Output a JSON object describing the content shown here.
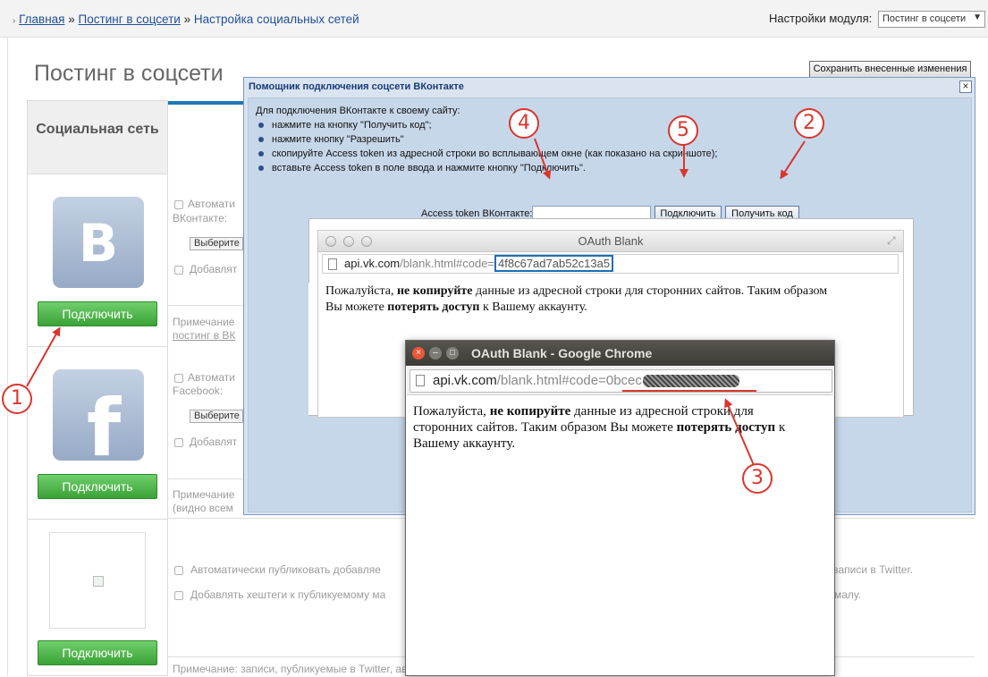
{
  "breadcrumb": {
    "home": "Главная",
    "sep": "»",
    "posting": "Постинг в соцсети",
    "current": "Настройка социальных сетей"
  },
  "module": {
    "label": "Настройки модуля:",
    "selected": "Постинг в соцсети"
  },
  "page": {
    "title": "Постинг в соцсети",
    "save_label": "Сохранить внесенные изменения"
  },
  "social": {
    "header": "Социальная сеть",
    "items": [
      {
        "logo": "vk-logo",
        "letter": "B",
        "connect_label": "Подключить"
      },
      {
        "logo": "facebook-logo",
        "letter": "f",
        "connect_label": "Подключить"
      },
      {
        "logo": "twitter-logo-broken",
        "letter": "",
        "connect_label": "Подключить"
      }
    ]
  },
  "settings": {
    "vk": {
      "auto_line1": "Автомати",
      "auto_line2": "ВКонтакте:",
      "select_btn": "Выберите",
      "add_label": "Добавлят",
      "note_line1": "Примечание",
      "note_line2": "постинг в ВК"
    },
    "fb": {
      "auto_line1": "Автомати",
      "auto_line2": "Facebook:",
      "select_btn": "Выберите",
      "add_label": "Добавлят",
      "note_line1": "Примечание",
      "note_line2": "(видно всем"
    },
    "tw": {
      "auto_left": "Автоматически публиковать добавляе",
      "auto_right": "записи в Twitter.",
      "hashtags_left": "Добавлять хештеги к публикуемому ма",
      "hashtags_right": "малу.",
      "note": "Примечание: записи, публикуемые в Twitter, автоматически сокращаются до 140 символов, вне зависимости от настроек модуля."
    }
  },
  "modal": {
    "title": "Помощник подключения соцсети ВКонтакте",
    "close": "×",
    "intro": "Для подключения ВКонтакте к своему сайту:",
    "steps": [
      "нажмите на кнопку \"Получить код\";",
      "нажмите кнопку \"Разрешить\"",
      "скопируйте Access token из адресной строки во всплывающем окне (как показано на скриншоте);",
      "вставьте Access token в поле ввода и нажмите кнопку \"Подключить\"."
    ],
    "token_label": "Access token ВКонтакте:",
    "token_value": "",
    "connect_label": "Подключить",
    "get_code_label": "Получить код"
  },
  "oauth_window": {
    "title": "OAuth Blank",
    "url_domain": "api.vk.com",
    "url_path": "/blank.html#code=",
    "code": "4f8c67ad7ab52c13a5",
    "warn_pre": "Пожалуйста, ",
    "warn_bold1": "не копируйте",
    "warn_mid": " данные из адресной строки для сторонних сайтов. Таким образом",
    "warn_line2_pre": "Вы можете ",
    "warn_bold2": "потерять доступ",
    "warn_post": " к Вашему аккаунту."
  },
  "chrome_window": {
    "title": "OAuth Blank - Google Chrome",
    "url_domain": "api.vk.com",
    "url_path": "/blank.html#code=",
    "code_visible": "0bcec",
    "warn_pre": "Пожалуйста, ",
    "warn_bold1": "не копируйте",
    "warn_mid": " данные из адресной строки для",
    "warn_line2": "сторонних сайтов. Таким образом Вы можете ",
    "warn_bold2": "потерять доступ",
    "warn_post": " к",
    "warn_line3": "Вашему аккаунту."
  },
  "annotations": {
    "n1": "1",
    "n2": "2",
    "n3": "3",
    "n4": "4",
    "n5": "5",
    "color": "#d9362d"
  }
}
